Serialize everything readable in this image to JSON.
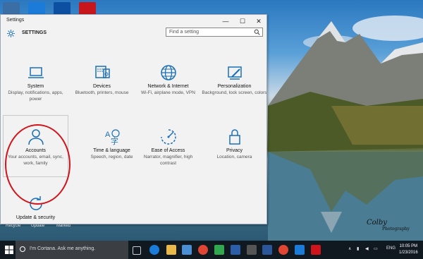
{
  "desktop": {
    "icon_labels": [
      "Recycle",
      "Update",
      "Wificard",
      "Marked"
    ],
    "signature": "Colby",
    "signature_sub": "Photography"
  },
  "window": {
    "title": "Settings",
    "controls": {
      "minimize": "—",
      "maximize": "☐",
      "close": "✕"
    },
    "heading": "SETTINGS",
    "search_placeholder": "Find a setting"
  },
  "tiles": [
    {
      "name": "System",
      "desc": "Display, notifications, apps, power",
      "icon": "laptop-icon"
    },
    {
      "name": "Devices",
      "desc": "Bluetooth, printers, mouse",
      "icon": "keyboard-icon"
    },
    {
      "name": "Network & Internet",
      "desc": "Wi-Fi, airplane mode, VPN",
      "icon": "globe-icon"
    },
    {
      "name": "Personalization",
      "desc": "Background, lock screen, colors",
      "icon": "paint-icon"
    },
    {
      "name": "Accounts",
      "desc": "Your accounts, email, sync, work, family",
      "icon": "person-icon"
    },
    {
      "name": "Time & language",
      "desc": "Speech, region, date",
      "icon": "language-icon"
    },
    {
      "name": "Ease of Access",
      "desc": "Narrator, magnifier, high contrast",
      "icon": "ease-of-access-icon"
    },
    {
      "name": "Privacy",
      "desc": "Location, camera",
      "icon": "lock-icon"
    },
    {
      "name": "Update & security",
      "desc": "",
      "icon": "update-icon"
    }
  ],
  "taskbar": {
    "cortana_text": "I'm Cortana. Ask me anything.",
    "language": "ENG",
    "time": "10:05 PM",
    "date": "1/23/2016"
  },
  "colors": {
    "accent": "#1b6fb6",
    "annotation": "#d0141b",
    "taskbar": "#101820"
  }
}
